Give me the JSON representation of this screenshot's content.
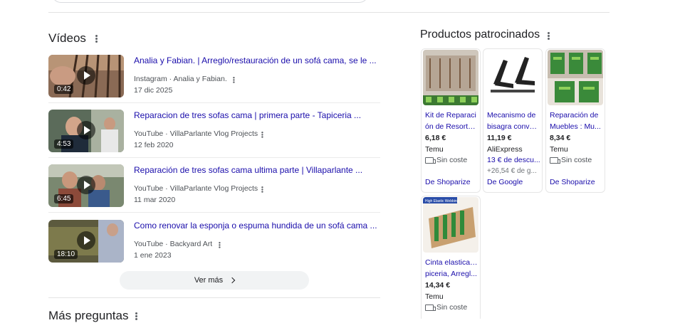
{
  "videos_section": {
    "title": "Vídeos",
    "items": [
      {
        "title": "Analia y Fabian. | Arreglo/restauración de un sofá cama, se le ...",
        "source": "Instagram · Analia y Fabian.",
        "date": "17 dic 2025",
        "duration": "0:42"
      },
      {
        "title": "Reparacion de tres sofas cama | primera parte - Tapiceria ...",
        "source": "YouTube · VillaParlante Vlog Projects",
        "date": "12 feb 2020",
        "duration": "4:53"
      },
      {
        "title": "Reparación de tres sofas cama ultima parte | Villaparlante ...",
        "source": "YouTube · VillaParlante Vlog Projects",
        "date": "11 mar 2020",
        "duration": "6:45"
      },
      {
        "title": "Como renovar la esponja o espuma hundida de un sofá cama ...",
        "source": "YouTube · Backyard Art",
        "date": "1 ene 2023",
        "duration": "18:10"
      }
    ],
    "more_label": "Ver más"
  },
  "next_section": {
    "title": "Más preguntas"
  },
  "sponsored": {
    "title": "Productos patrocinados",
    "products": [
      {
        "name_line1": "Kit de Reparaci",
        "name_line2": "ón de Resorte...",
        "price": "6,18 €",
        "store": "Temu",
        "shipping": "Sin coste",
        "from": "De Shoparize"
      },
      {
        "name_line1": "Mecanismo de",
        "name_line2": "bisagra conve...",
        "price": "11,19 €",
        "store": "AliExpress",
        "promo": "13 € de descu...",
        "extra": "+26,54 € de g...",
        "from": "De Google"
      },
      {
        "name_line1": "Reparación de",
        "name_line2": "Muebles : Mu...",
        "price": "8,34 €",
        "store": "Temu",
        "shipping": "Sin coste",
        "from": "De Shoparize"
      },
      {
        "name_line1": "Cinta elastica ta",
        "name_line2": "piceria, Arregl...",
        "price": "14,34 €",
        "store": "Temu",
        "shipping": "Sin coste",
        "badge": "High Elastic Webbing"
      }
    ]
  },
  "colors": {
    "link": "#1a0dab",
    "muted": "#4d5156",
    "divider": "#e3e3e3"
  }
}
